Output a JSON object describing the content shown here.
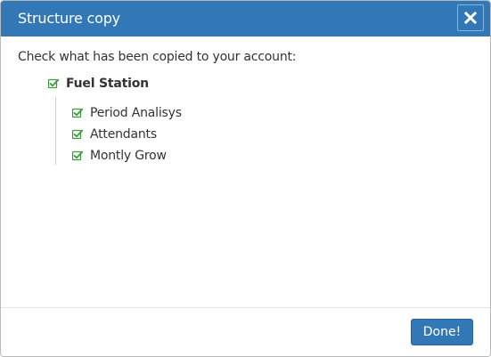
{
  "dialog": {
    "title": "Structure copy",
    "close_icon": "close-icon",
    "intro_text": "Check what has been copied to your account:",
    "tree": {
      "root": {
        "label": "Fuel Station",
        "checked": true,
        "icon": "check-square-icon"
      },
      "children": [
        {
          "label": "Period Analisys",
          "checked": true,
          "icon": "check-square-icon"
        },
        {
          "label": "Attendants",
          "checked": true,
          "icon": "check-square-icon"
        },
        {
          "label": "Montly Grow",
          "checked": true,
          "icon": "check-square-icon"
        }
      ]
    },
    "done_label": "Done!"
  },
  "colors": {
    "header": "#3277b6",
    "check": "#3c9a3c",
    "text": "#333333"
  }
}
